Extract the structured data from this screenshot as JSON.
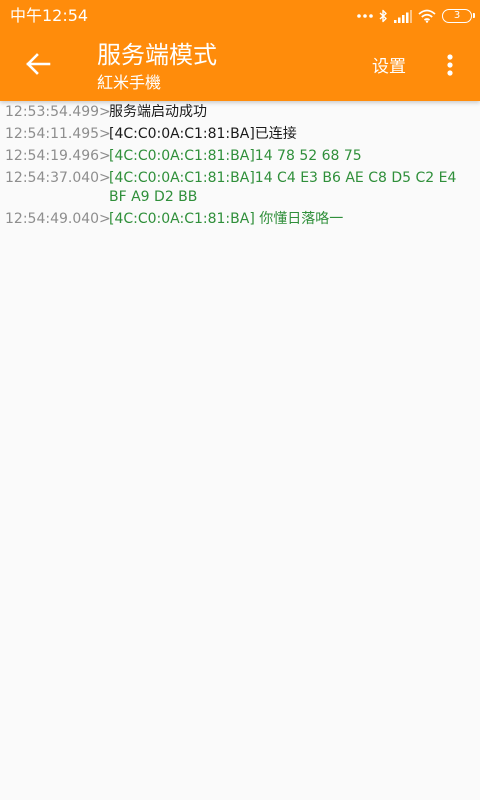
{
  "status_bar": {
    "time": "中午12:54",
    "battery_level": "3",
    "icons": [
      "more-dots-icon",
      "bluetooth-icon",
      "signal-icon",
      "wifi-icon",
      "battery-icon"
    ]
  },
  "toolbar": {
    "back_icon": "arrow-left-icon",
    "title": "服务端模式",
    "subtitle": "紅米手機",
    "settings_label": "设置",
    "overflow_icon": "more-vert-icon",
    "background_color": "#ff8c0b"
  },
  "colors": {
    "timestamp": "#8e8e8e",
    "system_message": "#1a1a1a",
    "received_message": "#2f8f3a",
    "background": "#fafafa"
  },
  "log": [
    {
      "timestamp": "12:53:54.499>",
      "message": "服务端启动成功",
      "type": "system"
    },
    {
      "timestamp": "12:54:11.495>",
      "message": "[4C:C0:0A:C1:81:BA]已连接",
      "type": "system"
    },
    {
      "timestamp": "12:54:19.496>",
      "message": "[4C:C0:0A:C1:81:BA]14 78 52 68 75",
      "type": "received"
    },
    {
      "timestamp": "12:54:37.040>",
      "message": "[4C:C0:0A:C1:81:BA]14 C4 E3 B6 AE C8 D5 C2 E4 BF A9 D2 BB",
      "type": "received"
    },
    {
      "timestamp": "12:54:49.040>",
      "message": "[4C:C0:0A:C1:81:BA] 你懂日落咯一",
      "type": "received"
    }
  ]
}
